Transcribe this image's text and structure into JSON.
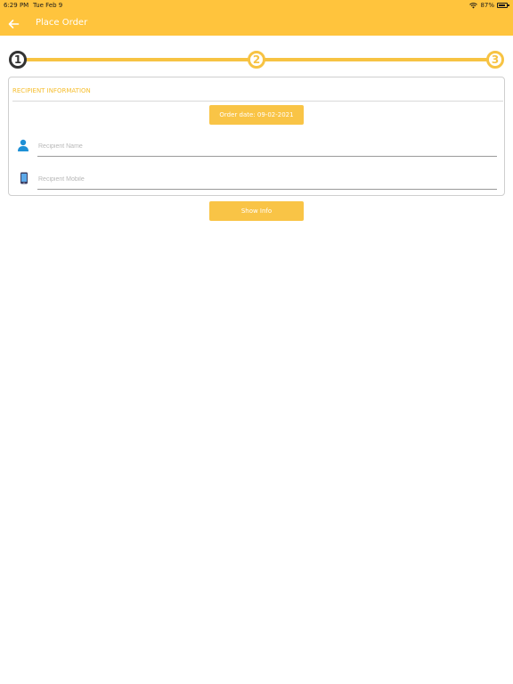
{
  "status_bar": {
    "time": "6:29 PM",
    "date": "Tue Feb 9",
    "battery": "87%"
  },
  "header": {
    "title": "Place Order",
    "back_icon": "arrow-left-icon"
  },
  "stepper": {
    "steps": [
      "1",
      "2",
      "3"
    ],
    "active_step": 1
  },
  "recipient_card": {
    "title": "RECIPIENT INFORMATION",
    "order_date_label": "Order date: 09-02-2021",
    "name_placeholder": "Recipient Name",
    "name_value": "",
    "mobile_placeholder": "Recipient Mobile",
    "mobile_value": "",
    "name_icon": "person-icon",
    "mobile_icon": "phone-icon"
  },
  "show_info_label": "Show Info",
  "colors": {
    "accent": "#FFC43D",
    "step_active": "#333333",
    "step_todo": "#F7C343",
    "icon_blue": "#1E90D6"
  }
}
